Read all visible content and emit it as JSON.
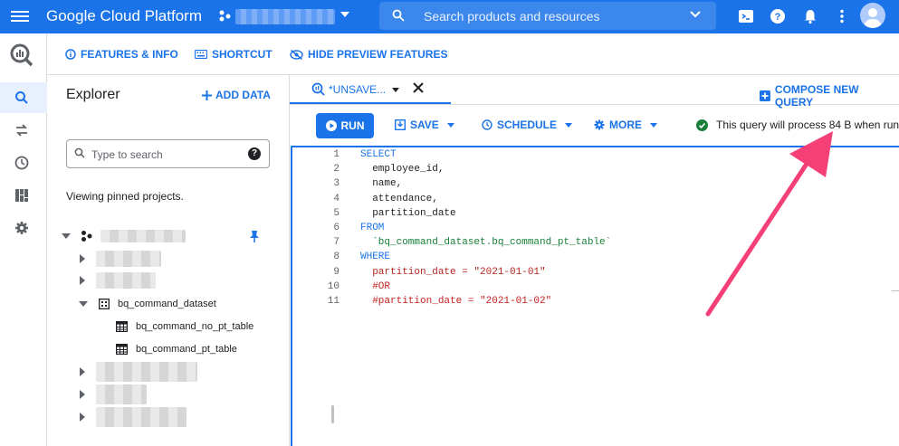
{
  "topbar": {
    "brand": "Google Cloud Platform",
    "search_placeholder": "Search products and resources"
  },
  "subbar": {
    "features": "FEATURES & INFO",
    "shortcut": "SHORTCUT",
    "hide_preview": "HIDE PREVIEW FEATURES"
  },
  "explorer": {
    "title": "Explorer",
    "add_data": "ADD DATA",
    "search_placeholder": "Type to search",
    "viewing": "Viewing pinned projects.",
    "dataset": "bq_command_dataset",
    "tables": [
      "bq_command_no_pt_table",
      "bq_command_pt_table"
    ]
  },
  "editor": {
    "tab_label": "*UNSAVE...",
    "compose": "COMPOSE NEW QUERY",
    "run": "RUN",
    "save": "SAVE",
    "schedule": "SCHEDULE",
    "more": "MORE",
    "status": "This query will process 84 B when run.",
    "code": [
      {
        "n": "1",
        "text": "SELECT",
        "cls": "kw"
      },
      {
        "n": "2",
        "text": "  employee_id,",
        "cls": "id"
      },
      {
        "n": "3",
        "text": "  name,",
        "cls": "id"
      },
      {
        "n": "4",
        "text": "  attendance,",
        "cls": "id"
      },
      {
        "n": "5",
        "text": "  partition_date",
        "cls": "id"
      },
      {
        "n": "6",
        "text": "FROM",
        "cls": "kw"
      },
      {
        "n": "7",
        "text": "  `bq_command_dataset.bq_command_pt_table`",
        "cls": "str"
      },
      {
        "n": "8",
        "text": "WHERE",
        "cls": "kw"
      },
      {
        "n": "9",
        "text": "  partition_date = \"2021-01-01\"",
        "cls": "red"
      },
      {
        "n": "10",
        "text": "  #OR",
        "cls": "com"
      },
      {
        "n": "11",
        "text": "  #partition_date = \"2021-01-02\"",
        "cls": "com"
      }
    ]
  },
  "colors": {
    "primary": "#1a73e8",
    "annotation_arrow": "#f43f77"
  }
}
